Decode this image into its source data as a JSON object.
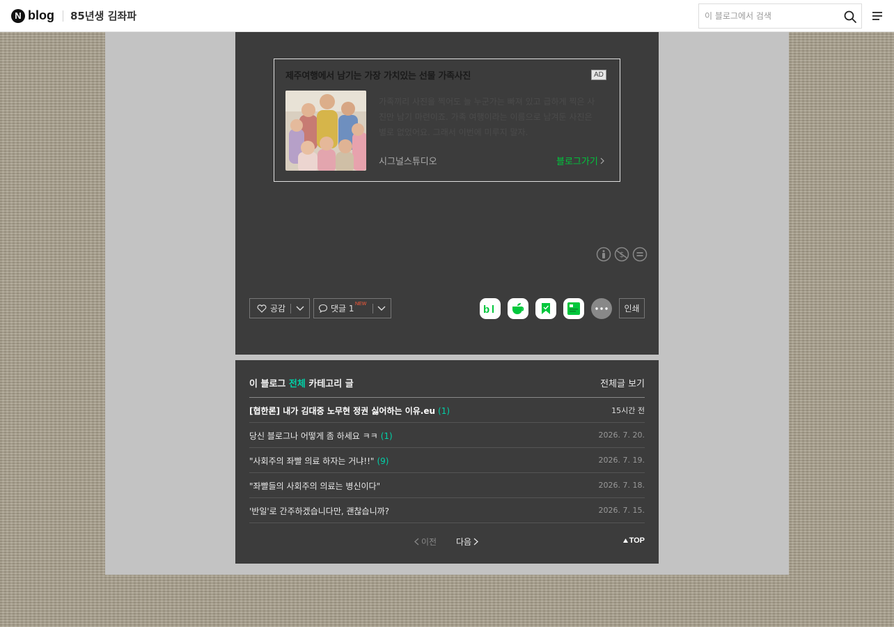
{
  "header": {
    "logo_mark": "N",
    "logo_text": "blog",
    "blog_name": "85년생 김좌파",
    "search_placeholder": "이 블로그에서 검색"
  },
  "ad": {
    "title": "제주여행에서 남기는 가장 가치있는 선물 가족사진",
    "badge": "AD",
    "description": "가족끼리 사진을 찍어도 늘 누군가는 빠져 있고 급하게 찍은 사진만 남기 마련이죠. 가족 여행이라는 이름으로 남겨둔 사진은 별로 없었어요. 그래서 이번에 미루지 말자.",
    "source": "시그널스튜디오",
    "link_label": "블로그가기"
  },
  "actions": {
    "like_label": "공감",
    "comment_label": "댓글 1",
    "new_badge": "NEW",
    "print_label": "인쇄"
  },
  "category_list": {
    "prefix": "이 블로그",
    "category": "전체",
    "suffix": "카테고리 글",
    "view_all": "전체글 보기",
    "posts": [
      {
        "title": "[협한론] 내가 김대중 노무현 정권 싫어하는 이유.eu",
        "count": "(1)",
        "date": "15시간 전"
      },
      {
        "title": "당신 블로그나 어떻게 좀 하세요 ㅋㅋ",
        "count": "(1)",
        "date": "2026. 7. 20."
      },
      {
        "title": "\"사회주의 좌빨 의료 하자는 거냐!!\"",
        "count": "(9)",
        "date": "2026. 7. 19."
      },
      {
        "title": "\"좌빨들의 사회주의 의료는 병신이다\"",
        "count": "",
        "date": "2026. 7. 18."
      },
      {
        "title": "'반일'로 간주하겠습니다만, 괜찮습니까?",
        "count": "",
        "date": "2026. 7. 15."
      }
    ],
    "prev_label": "이전",
    "next_label": "다음",
    "top_label": "TOP"
  },
  "colors": {
    "accent_green": "#00c73c",
    "accent_mint": "#00d2a8",
    "panel_dark": "#3c3c3c"
  }
}
